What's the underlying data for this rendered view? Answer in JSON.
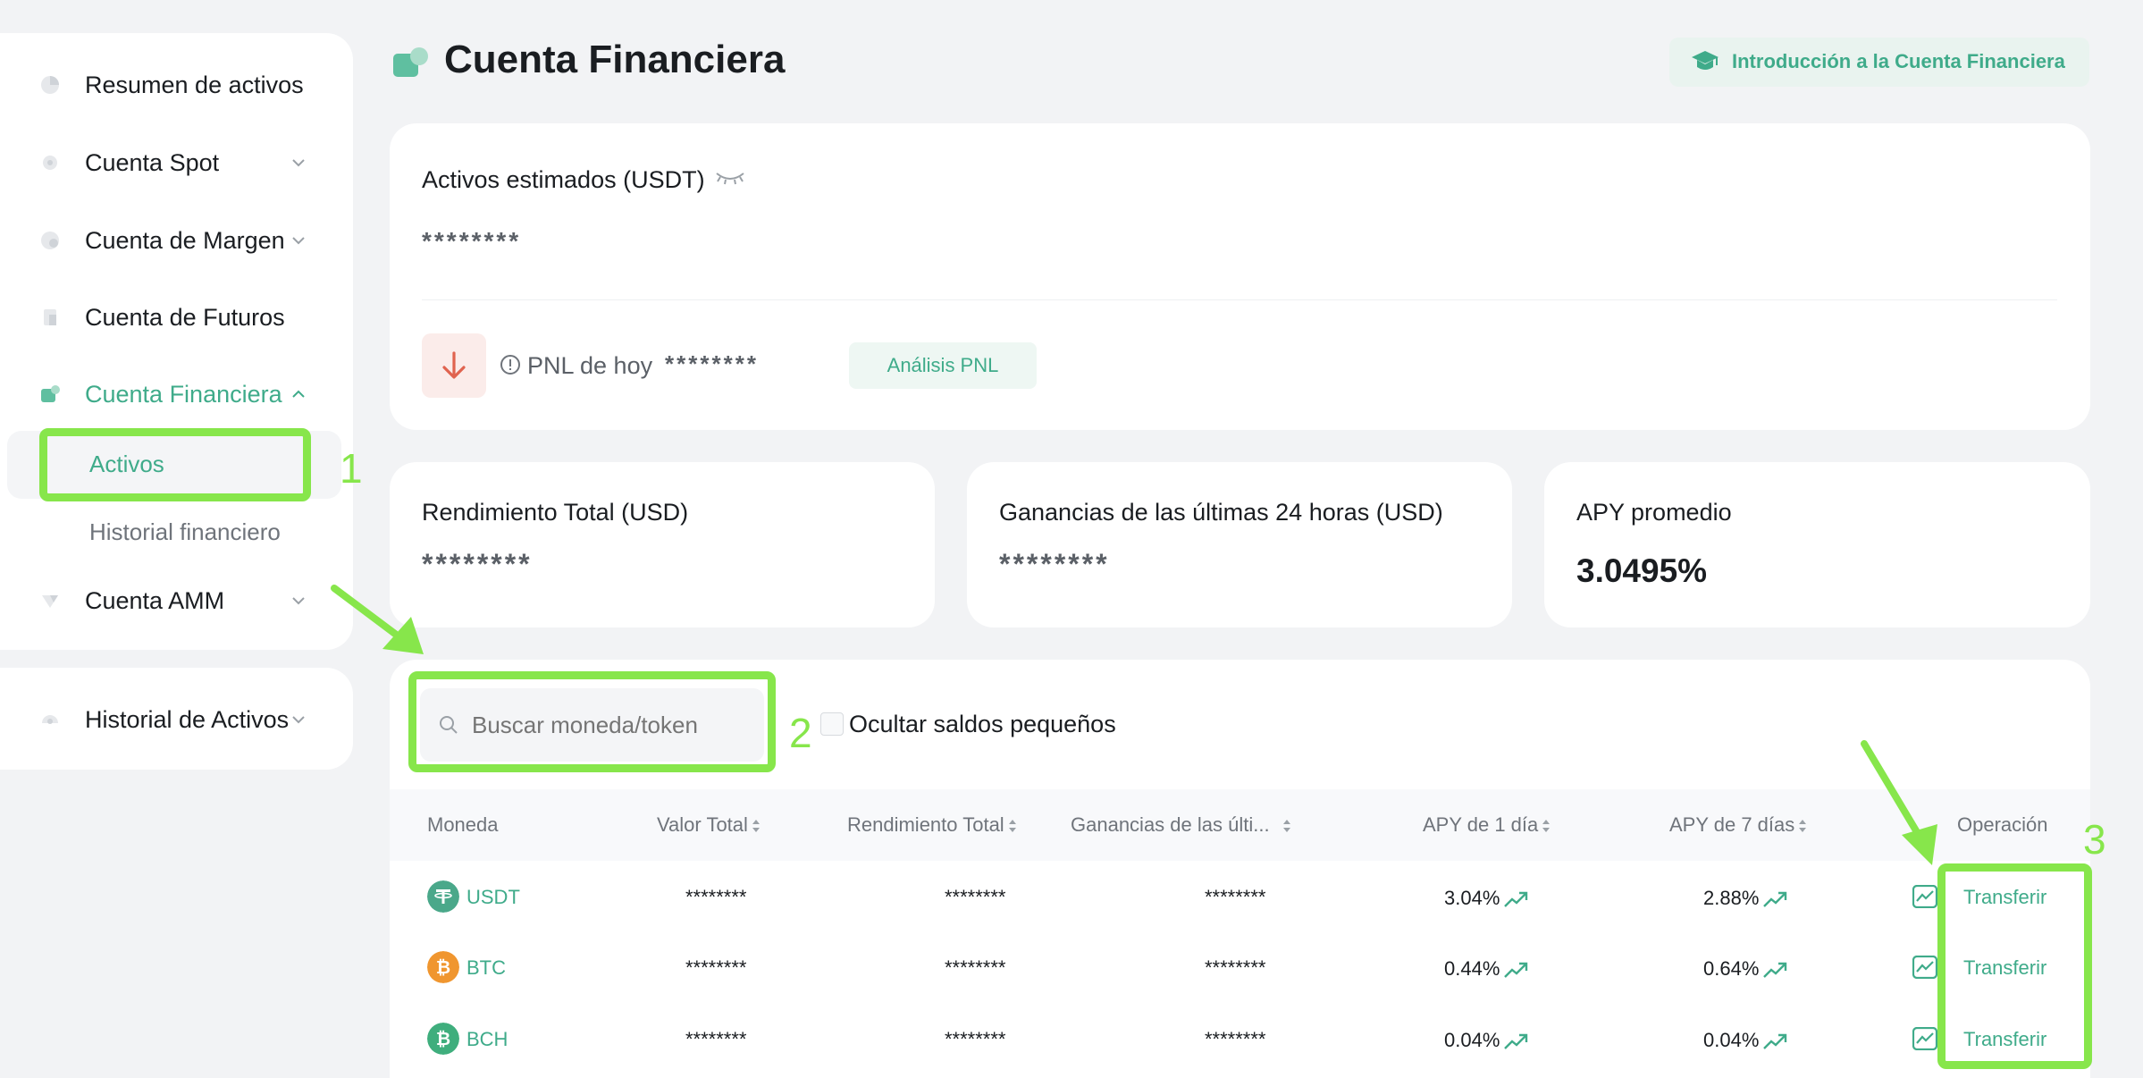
{
  "sidebar": {
    "items": [
      {
        "label": "Resumen de activos",
        "icon": "pie-chart-icon"
      },
      {
        "label": "Cuenta Spot",
        "icon": "gear-icon"
      },
      {
        "label": "Cuenta de Margen",
        "icon": "margin-icon"
      },
      {
        "label": "Cuenta de Futuros",
        "icon": "futures-icon"
      },
      {
        "label": "Cuenta Financiera",
        "icon": "finance-icon"
      },
      {
        "label": "Cuenta AMM",
        "icon": "amm-icon"
      }
    ],
    "sub_items": [
      {
        "label": "Activos"
      },
      {
        "label": "Historial financiero"
      }
    ],
    "history": {
      "label": "Historial de Activos",
      "icon": "history-icon"
    }
  },
  "header": {
    "title": "Cuenta Financiera",
    "intro_link": "Introducción a la Cuenta Financiera"
  },
  "estimated": {
    "label": "Activos estimados (USDT)",
    "value": "********",
    "pnl_label": "PNL de hoy",
    "pnl_value": "********",
    "pnl_button": "Análisis PNL"
  },
  "stats": [
    {
      "label": "Rendimiento Total (USD)",
      "value": "********"
    },
    {
      "label": "Ganancias de las últimas 24 horas (USD)",
      "value": "********"
    },
    {
      "label": "APY promedio",
      "value": "3.0495%"
    }
  ],
  "search": {
    "placeholder": "Buscar moneda/token"
  },
  "hide_small": {
    "label": "Ocultar saldos pequeños"
  },
  "table": {
    "headers": [
      "Moneda",
      "Valor Total",
      "Rendimiento Total",
      "Ganancias de las últi...",
      "APY de 1 día",
      "APY de 7 días",
      "Operación"
    ],
    "rows": [
      {
        "coin": "USDT",
        "total": "********",
        "yield": "********",
        "gain": "********",
        "apy1": "3.04%",
        "apy7": "2.88%",
        "action": "Transferir",
        "color": "#4aa88a"
      },
      {
        "coin": "BTC",
        "total": "********",
        "yield": "********",
        "gain": "********",
        "apy1": "0.44%",
        "apy7": "0.64%",
        "action": "Transferir",
        "color": "#f0962f"
      },
      {
        "coin": "BCH",
        "total": "********",
        "yield": "********",
        "gain": "********",
        "apy1": "0.04%",
        "apy7": "0.04%",
        "action": "Transferir",
        "color": "#3fae7d"
      }
    ]
  },
  "annotations": [
    "1",
    "2",
    "3"
  ],
  "colors": {
    "accent": "#3fab8a",
    "highlight": "#87e64b",
    "pnl_down": "#e0634f"
  }
}
